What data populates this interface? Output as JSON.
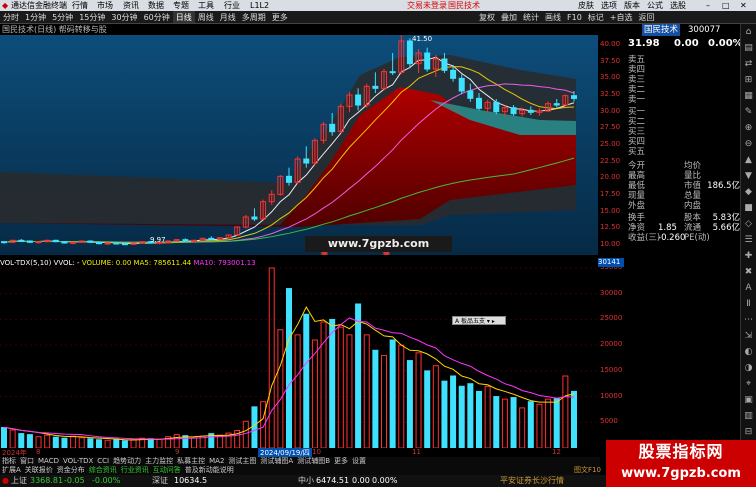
{
  "titlebar": {
    "app": "通达信金融终端",
    "menus": [
      "行情",
      "市场",
      "资讯",
      "数据",
      "专题",
      "工具",
      "行业",
      "L1L2"
    ],
    "login": "交易未登录",
    "stock": "国民技术",
    "windows": [
      "皮肤",
      "选项",
      "版本",
      "公式",
      "选股"
    ]
  },
  "toolbar": {
    "periods": [
      "分时",
      "1分钟",
      "5分钟",
      "15分钟",
      "30分钟",
      "60分钟",
      "日线",
      "周线",
      "月线",
      "多周期",
      "更多"
    ],
    "right": [
      "复权",
      "叠加",
      "统计",
      "画线",
      "F10",
      "标记",
      "+自选",
      "返回"
    ]
  },
  "infobar": {
    "text": "国民技术(日线)  帮码转移与股"
  },
  "price_axis": [
    "40.00",
    "37.50",
    "35.00",
    "32.50",
    "30.00",
    "27.50",
    "25.00",
    "22.50",
    "20.00",
    "17.50",
    "15.00",
    "12.50",
    "10.00"
  ],
  "price_labels": {
    "high": "41.50",
    "low": "9.97"
  },
  "vol_header": {
    "name": "VOL-TDX(5,10)",
    "vvol": "VVOL: -",
    "volume": "VOLUME: 0.00",
    "ma5": "MA5: 785611.44",
    "ma10": "MA10: 793001.13"
  },
  "vol_axis": [
    "35000",
    "30000",
    "25000",
    "20000",
    "15000",
    "10000",
    "5000"
  ],
  "vol_tag": "30141",
  "date_axis": {
    "start": "2024年",
    "m1": "8",
    "m2": "9",
    "cursor": "2024/09/19/四",
    "m3": "10",
    "m4": "11",
    "m5": "12"
  },
  "popup": "A 板品五支 ▾ ▸",
  "quote": {
    "name": "国民技术",
    "code": "300077",
    "price": "31.98",
    "change": "0.00",
    "pct": "0.00%",
    "sell": [
      "卖五",
      "卖四",
      "卖三",
      "卖二",
      "卖一"
    ],
    "buy": [
      "买一",
      "买二",
      "买三",
      "买四",
      "买五"
    ],
    "stats": [
      [
        "今开",
        "",
        "均价",
        ""
      ],
      [
        "最高",
        "",
        "量比",
        ""
      ],
      [
        "最低",
        "",
        "市值",
        "186.5亿"
      ],
      [
        "现量",
        "",
        "总量",
        ""
      ],
      [
        "外盘",
        "",
        "内盘",
        ""
      ]
    ],
    "stats2": [
      [
        "换手",
        "",
        "股本",
        "5.83亿"
      ],
      [
        "净资",
        "1.85",
        "流通",
        "5.66亿"
      ],
      [
        "收益(三)",
        "-0.260",
        "PE(动)",
        ""
      ]
    ]
  },
  "right_tools": [
    "⌂",
    "▤",
    "⇄",
    "⊞",
    "▦",
    "✎",
    "⊕",
    "⊖",
    "▲",
    "▼",
    "◆",
    "■",
    "◇",
    "☰",
    "✚",
    "✖",
    "A",
    "Ⅱ",
    "⋯",
    "⇲",
    "◐",
    "◑",
    "⌖",
    "▣",
    "▥",
    "⊟"
  ],
  "tabs1": [
    "指标",
    "窗口",
    "MACD",
    "VOL-TDX",
    "CCI",
    "趋势动力",
    "主力监控",
    "私募主控",
    "MA2",
    "测试主图",
    "测试辅图A",
    "测试辅图B",
    "更多",
    "设置"
  ],
  "tabs2": [
    "扩展A",
    "关联报价",
    "资金分布",
    "综合资讯",
    "行业资讯",
    "互动问答",
    "普及新动能说明"
  ],
  "status": {
    "sh": "上证",
    "sh_val": "3368.81",
    "sh_chg": "-0.05",
    "sh_pct": "-0.00%",
    "sz": "深证",
    "sz_val": "10634.5",
    "zx": "中小",
    "zx_val": "6474.51",
    "zx_chg": "0.00",
    "zx_pct": "0.00%",
    "broker": "平安证券长沙行情",
    "f10": "图文F10"
  },
  "watermark": {
    "line1": "股票指标网",
    "line2": "www.7gpzb.com"
  },
  "chart_wm": "www.7gpzb.com",
  "chart_data": [
    {
      "type": "candlestick",
      "title": "",
      "y_axis": [
        10,
        40
      ],
      "candles": [
        [
          10.5,
          10.6,
          10.2,
          10.4
        ],
        [
          10.4,
          10.8,
          10.3,
          10.7
        ],
        [
          10.7,
          10.9,
          10.5,
          10.6
        ],
        [
          10.6,
          10.7,
          10.3,
          10.4
        ],
        [
          10.4,
          10.6,
          10.2,
          10.5
        ],
        [
          10.5,
          10.8,
          10.4,
          10.7
        ],
        [
          10.7,
          10.8,
          10.4,
          10.5
        ],
        [
          10.5,
          10.6,
          10.2,
          10.3
        ],
        [
          10.3,
          10.5,
          10.1,
          10.4
        ],
        [
          10.4,
          10.7,
          10.3,
          10.6
        ],
        [
          10.6,
          10.7,
          10.3,
          10.4
        ],
        [
          10.4,
          10.5,
          10.1,
          10.2
        ],
        [
          10.2,
          10.4,
          10.0,
          10.3
        ],
        [
          10.3,
          10.5,
          10.1,
          10.2
        ],
        [
          10.2,
          10.3,
          9.97,
          10.1
        ],
        [
          10.1,
          10.4,
          10.0,
          10.3
        ],
        [
          10.3,
          10.6,
          10.2,
          10.5
        ],
        [
          10.5,
          10.6,
          10.2,
          10.3
        ],
        [
          10.3,
          10.5,
          10.1,
          10.4
        ],
        [
          10.4,
          10.7,
          10.3,
          10.6
        ],
        [
          10.6,
          10.9,
          10.5,
          10.8
        ],
        [
          10.8,
          11.0,
          10.5,
          10.6
        ],
        [
          10.6,
          10.8,
          10.4,
          10.7
        ],
        [
          10.7,
          11.1,
          10.6,
          11.0
        ],
        [
          11.0,
          11.3,
          10.8,
          10.9
        ],
        [
          10.9,
          11.2,
          10.7,
          11.1
        ],
        [
          11.1,
          11.6,
          11.0,
          11.5
        ],
        [
          11.5,
          12.8,
          11.4,
          12.7
        ],
        [
          12.7,
          14.5,
          12.5,
          14.2
        ],
        [
          14.2,
          15.5,
          13.6,
          13.9
        ],
        [
          13.9,
          16.8,
          13.8,
          16.5
        ],
        [
          16.5,
          18.2,
          16.0,
          17.6
        ],
        [
          17.6,
          20.5,
          17.4,
          20.3
        ],
        [
          20.3,
          21.6,
          18.9,
          19.4
        ],
        [
          19.4,
          23.3,
          19.2,
          22.9
        ],
        [
          22.9,
          24.8,
          21.6,
          22.3
        ],
        [
          22.3,
          26.0,
          22.0,
          25.7
        ],
        [
          25.7,
          28.5,
          25.2,
          28.1
        ],
        [
          28.1,
          29.8,
          26.4,
          27.0
        ],
        [
          27.0,
          31.2,
          26.8,
          30.8
        ],
        [
          30.8,
          33.0,
          29.9,
          32.5
        ],
        [
          32.5,
          33.5,
          30.2,
          31.0
        ],
        [
          31.0,
          34.2,
          30.6,
          33.8
        ],
        [
          33.8,
          35.9,
          32.8,
          33.5
        ],
        [
          33.5,
          36.4,
          33.2,
          36.0
        ],
        [
          36.0,
          38.8,
          35.5,
          35.9
        ],
        [
          35.9,
          41.5,
          35.7,
          40.6
        ],
        [
          40.6,
          41.0,
          36.5,
          37.2
        ],
        [
          37.2,
          39.4,
          35.8,
          38.8
        ],
        [
          38.8,
          39.6,
          36.0,
          36.4
        ],
        [
          36.4,
          38.5,
          35.2,
          37.9
        ],
        [
          37.9,
          38.8,
          35.8,
          36.2
        ],
        [
          36.2,
          37.0,
          34.5,
          35.0
        ],
        [
          35.0,
          35.6,
          32.6,
          33.1
        ],
        [
          33.1,
          34.2,
          31.5,
          32.0
        ],
        [
          32.0,
          32.8,
          30.2,
          30.5
        ],
        [
          30.5,
          31.8,
          29.8,
          31.4
        ],
        [
          31.4,
          31.9,
          29.6,
          30.0
        ],
        [
          30.0,
          30.9,
          29.2,
          30.6
        ],
        [
          30.6,
          31.0,
          29.4,
          29.7
        ],
        [
          29.7,
          30.6,
          29.3,
          30.2
        ],
        [
          30.2,
          30.8,
          29.5,
          29.9
        ],
        [
          29.9,
          30.5,
          29.4,
          30.1
        ],
        [
          30.1,
          31.5,
          30.0,
          31.2
        ],
        [
          31.2,
          31.9,
          30.6,
          31.0
        ],
        [
          31.0,
          32.6,
          30.9,
          32.4
        ],
        [
          32.4,
          33.1,
          31.5,
          31.98
        ]
      ]
    },
    {
      "type": "bar",
      "title": "",
      "y_axis": [
        0,
        35000
      ],
      "values": [
        4000,
        3500,
        2800,
        2600,
        2200,
        2500,
        2100,
        1900,
        2300,
        2000,
        1800,
        1600,
        1500,
        1700,
        1400,
        1600,
        1900,
        1800,
        1700,
        2200,
        2600,
        2400,
        2000,
        2300,
        2800,
        2500,
        2900,
        3400,
        5200,
        8000,
        9000,
        35000,
        23000,
        31000,
        22000,
        26000,
        21000,
        24500,
        25000,
        23500,
        22000,
        28000,
        22000,
        19000,
        18000,
        21000,
        20000,
        17000,
        18500,
        15000,
        16000,
        13000,
        14000,
        12000,
        12500,
        11000,
        12000,
        10000,
        9500,
        9800,
        7800,
        9000,
        8500,
        9500,
        9700,
        14000,
        11000
      ]
    }
  ]
}
